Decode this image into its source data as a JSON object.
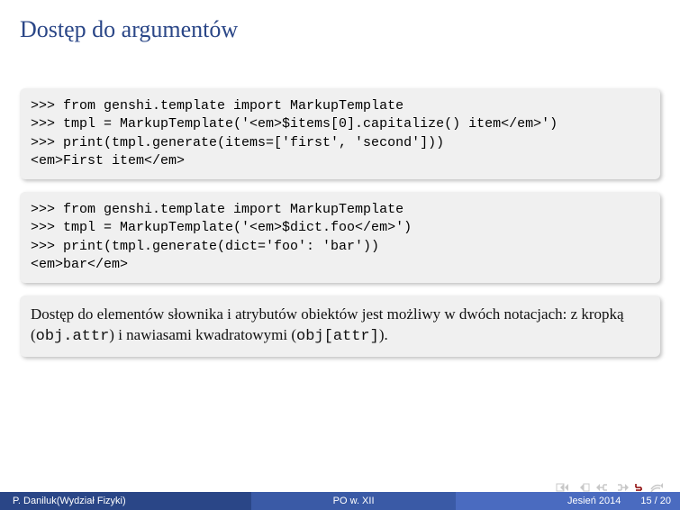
{
  "title": "Dostęp do argumentów",
  "code1": ">>> from genshi.template import MarkupTemplate\n>>> tmpl = MarkupTemplate('<em>$items[0].capitalize() item</em>')\n>>> print(tmpl.generate(items=['first', 'second']))\n<em>First item</em>",
  "code2": ">>> from genshi.template import MarkupTemplate\n>>> tmpl = MarkupTemplate('<em>$dict.foo</em>')\n>>> print(tmpl.generate(dict='foo': 'bar'))\n<em>bar</em>",
  "note": {
    "pre": "Dostęp do elementów słownika i atrybutów obiektów jest możliwy w dwóch notacjach: z kropką (",
    "m1": "obj.attr",
    "mid": ") i nawiasami kwadratowymi (",
    "m2": "obj[attr]",
    "post": ")."
  },
  "footer": {
    "author": "P. Daniluk(Wydział Fizyki)",
    "center": "PO w. XII",
    "term": "Jesień 2014",
    "page": "15 / 20"
  }
}
